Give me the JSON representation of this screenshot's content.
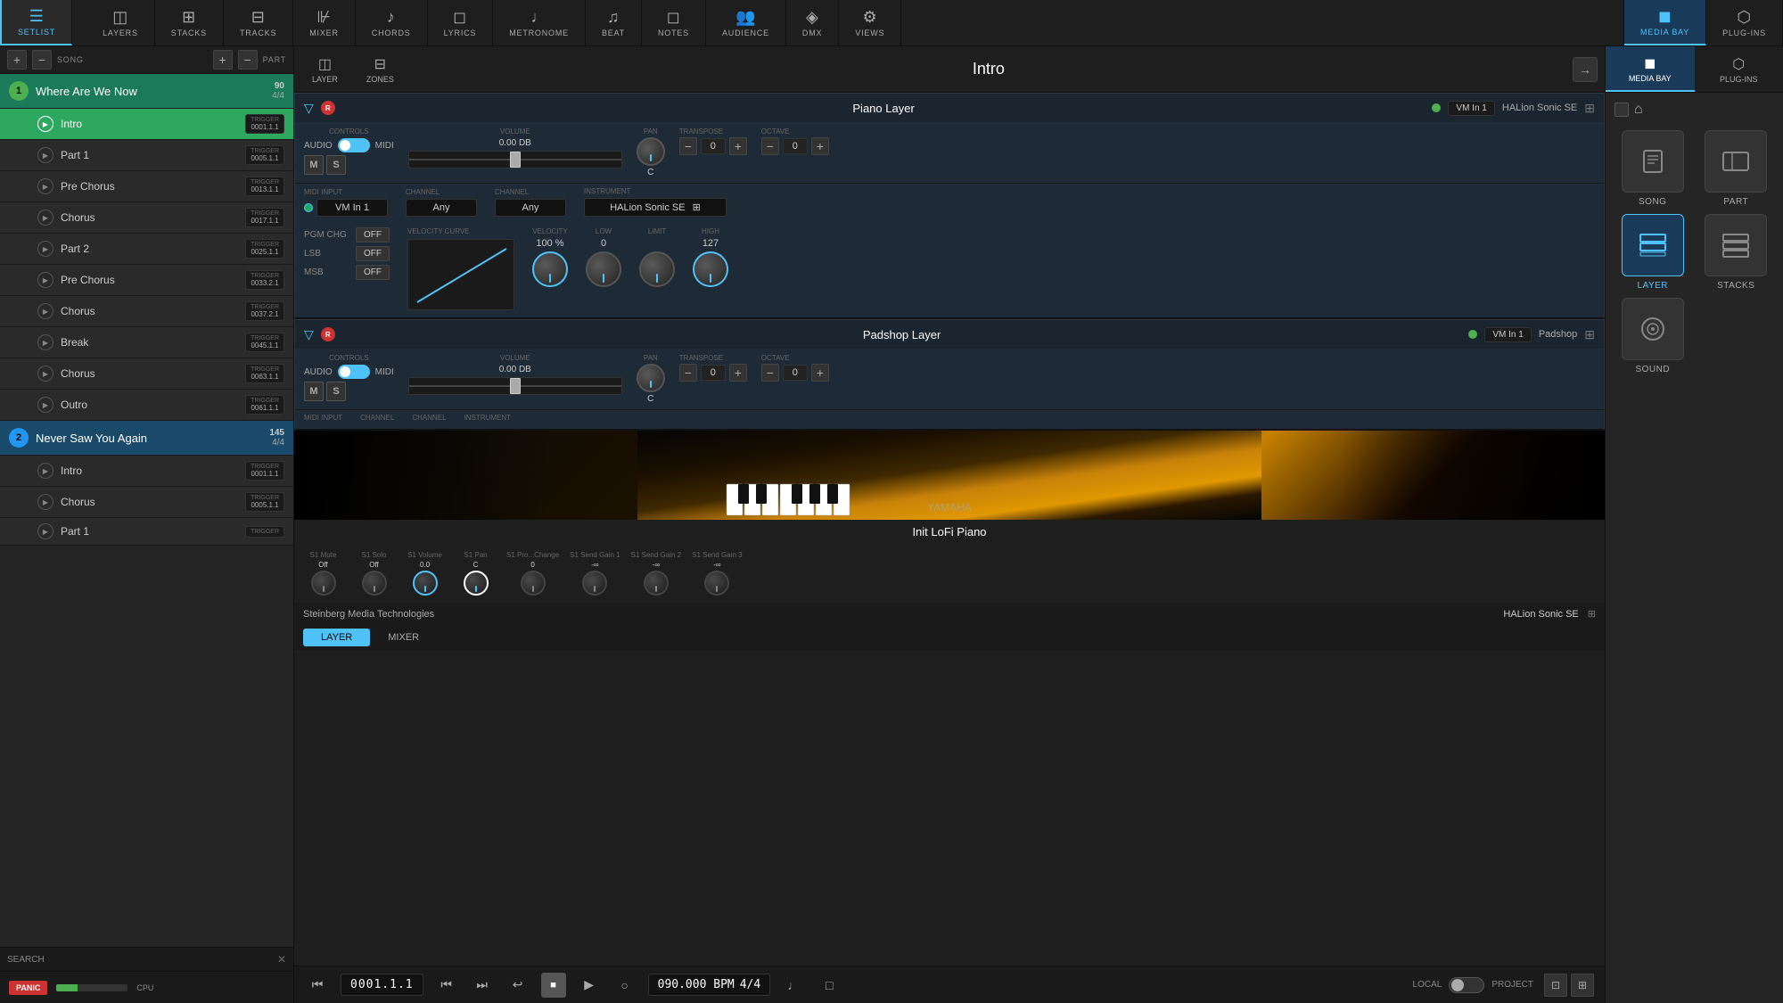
{
  "topNav": {
    "items": [
      {
        "id": "setlist",
        "label": "SETLIST",
        "icon": "☰",
        "active": true
      },
      {
        "id": "layers",
        "label": "LAYERS",
        "icon": "◫",
        "active": false
      },
      {
        "id": "stacks",
        "label": "STACKS",
        "icon": "⊞",
        "active": false
      },
      {
        "id": "tracks",
        "label": "TRACKS",
        "icon": "⊟",
        "active": false
      },
      {
        "id": "mixer",
        "label": "MIXER",
        "icon": "⊮",
        "active": false
      },
      {
        "id": "chords",
        "label": "CHORDS",
        "icon": "♪",
        "active": false
      },
      {
        "id": "lyrics",
        "label": "LYRICS",
        "icon": "◫",
        "active": false
      },
      {
        "id": "metronome",
        "label": "METRONOME",
        "icon": "♩",
        "active": false
      },
      {
        "id": "beat",
        "label": "BEAT",
        "icon": "♫",
        "active": false
      },
      {
        "id": "notes",
        "label": "NOTES",
        "icon": "◻",
        "active": false
      },
      {
        "id": "audience",
        "label": "AUDIENCE",
        "icon": "👥",
        "active": false
      },
      {
        "id": "dmx",
        "label": "DMX",
        "icon": "◈",
        "active": false
      },
      {
        "id": "views",
        "label": "VIEWS",
        "icon": "⚙",
        "active": false
      }
    ],
    "rightItems": [
      {
        "id": "media-bay",
        "label": "MEDIA BAY",
        "icon": "◼",
        "active": true
      },
      {
        "id": "plug-ins",
        "label": "PLUG-INS",
        "icon": "⬡",
        "active": false
      }
    ]
  },
  "sidebar": {
    "songLabel": "SONG",
    "partLabel": "PART",
    "searchLabel": "SEARCH",
    "songs": [
      {
        "num": 1,
        "title": "Where Are We Now",
        "bpm": "90",
        "sig": "4/4",
        "active": true,
        "parts": [
          {
            "name": "Intro",
            "trigger": "0001.1.1",
            "active": true
          },
          {
            "name": "Part 1",
            "trigger": "0005.1.1",
            "active": false
          },
          {
            "name": "Pre Chorus",
            "trigger": "0013.1.1",
            "active": false
          },
          {
            "name": "Chorus",
            "trigger": "0017.1.1",
            "active": false
          },
          {
            "name": "Part 2",
            "trigger": "0025.1.1",
            "active": false
          },
          {
            "name": "Pre Chorus",
            "trigger": "0033.2.1",
            "active": false
          },
          {
            "name": "Chorus",
            "trigger": "0037.2.1",
            "active": false
          },
          {
            "name": "Break",
            "trigger": "0045.1.1",
            "active": false
          },
          {
            "name": "Chorus",
            "trigger": "0063.1.1",
            "active": false
          },
          {
            "name": "Outro",
            "trigger": "0061.1.1",
            "active": false
          }
        ]
      },
      {
        "num": 2,
        "title": "Never Saw You Again",
        "bpm": "145",
        "sig": "4/4",
        "active": false,
        "parts": [
          {
            "name": "Intro",
            "trigger": "0001.1.1",
            "active": false
          },
          {
            "name": "Chorus",
            "trigger": "0005.1.1",
            "active": false
          },
          {
            "name": "Part 1",
            "trigger": "",
            "active": false
          }
        ]
      }
    ]
  },
  "centerToolbar": {
    "layerLabel": "LAYER",
    "zonesLabel": "ZONES",
    "sectionName": "Intro"
  },
  "layers": [
    {
      "name": "Piano Layer",
      "recordBtnLabel": "R",
      "active": true,
      "midiInput": "VM In 1",
      "channel_input": "Any",
      "channel_output": "Any",
      "instrument": "HALion Sonic SE",
      "volume": "0.00 dB",
      "pan": "C",
      "transpose": "0",
      "octave": "0",
      "velocity": "100 %",
      "low": "0",
      "high": "127",
      "limit": "LIMIT",
      "mLabel": "M",
      "sLabel": "S",
      "pgmChg": "OFF",
      "lsb": "OFF",
      "msb": "OFF",
      "audioLabel": "AUDIO",
      "midiLabel": "MIDI",
      "controlsLabel": "CONTROLS",
      "volumeLabel": "VOLUME",
      "panLabel": "PAN",
      "transposeLabel": "TRANSPOSE",
      "octaveLabel": "OCTAVE",
      "midiInputLabel": "MIDI INPUT",
      "channelLabel": "CHANNEL",
      "instrumentLabel": "INSTRUMENT",
      "velocityLabel": "VELOCITY",
      "lowLabel": "LOW",
      "highLabel": "HIGH",
      "velocityCurveLabel": "VELOCITY CURVE",
      "pgmChgLabel": "PGM CHG",
      "lsbLabel": "LSB",
      "msbLabel": "MSB"
    },
    {
      "name": "Padshop Layer",
      "recordBtnLabel": "R",
      "active": true,
      "midiInput": "VM In 1",
      "channel_input": "Any",
      "channel_output": "Any",
      "instrument": "Padshop",
      "volume": "0.00 dB",
      "pan": "C",
      "transpose": "0",
      "octave": "0",
      "mLabel": "M",
      "sLabel": "S",
      "audioLabel": "AUDIO",
      "midiLabel": "MIDI",
      "controlsLabel": "CONTROLS",
      "volumeLabel": "VOLUME",
      "panLabel": "PAN",
      "transposeLabel": "TRANSPOSE",
      "octaveLabel": "OCTAVE",
      "midiInputLabel": "MIDI INPUT",
      "channelLabel": "CHANNEL",
      "instrumentLabel": "INSTRUMENT"
    }
  ],
  "instrumentPreview": {
    "title": "Init LoFi Piano",
    "pluginName": "HALion Sonic SE",
    "sendControls": [
      {
        "label": "S1 Mute",
        "value": "Off"
      },
      {
        "label": "S1 Solo",
        "value": "Off"
      },
      {
        "label": "S1 Volume",
        "value": "0.0"
      },
      {
        "label": "S1 Pan",
        "value": "C"
      },
      {
        "label": "S1 Pro...Change",
        "value": "0"
      },
      {
        "label": "S1 Send Gain 1",
        "value": "-∞"
      },
      {
        "label": "S1 Send Gain 2",
        "value": "-∞"
      },
      {
        "label": "S1 Send Gain 3",
        "value": "-∞"
      }
    ],
    "layerTab": "LAYER",
    "mixerTab": "MIXER",
    "steinbergLabel": "Steinberg Media Technologies"
  },
  "transport": {
    "position": "0001.1.1",
    "bpm": "090.000 BPM",
    "timeSig": "4/4"
  },
  "rightPanel": {
    "mediaBayLabel": "MEDIA BAY",
    "plugInsLabel": "PLUG-INS",
    "items": [
      {
        "id": "song",
        "label": "SONG",
        "icon": "♪",
        "active": false
      },
      {
        "id": "part",
        "label": "PART",
        "icon": "◫",
        "active": false
      },
      {
        "id": "layer",
        "label": "LAYER",
        "icon": "◫",
        "active": false
      },
      {
        "id": "stacks",
        "label": "STACKS",
        "icon": "⊞",
        "active": false
      },
      {
        "id": "sound",
        "label": "SOUND",
        "icon": "◉",
        "active": false
      }
    ]
  },
  "bottomBar": {
    "panicLabel": "PANIC",
    "cpuLabel": "CPU",
    "localLabel": "LOCAL",
    "projectLabel": "PROJECT"
  }
}
